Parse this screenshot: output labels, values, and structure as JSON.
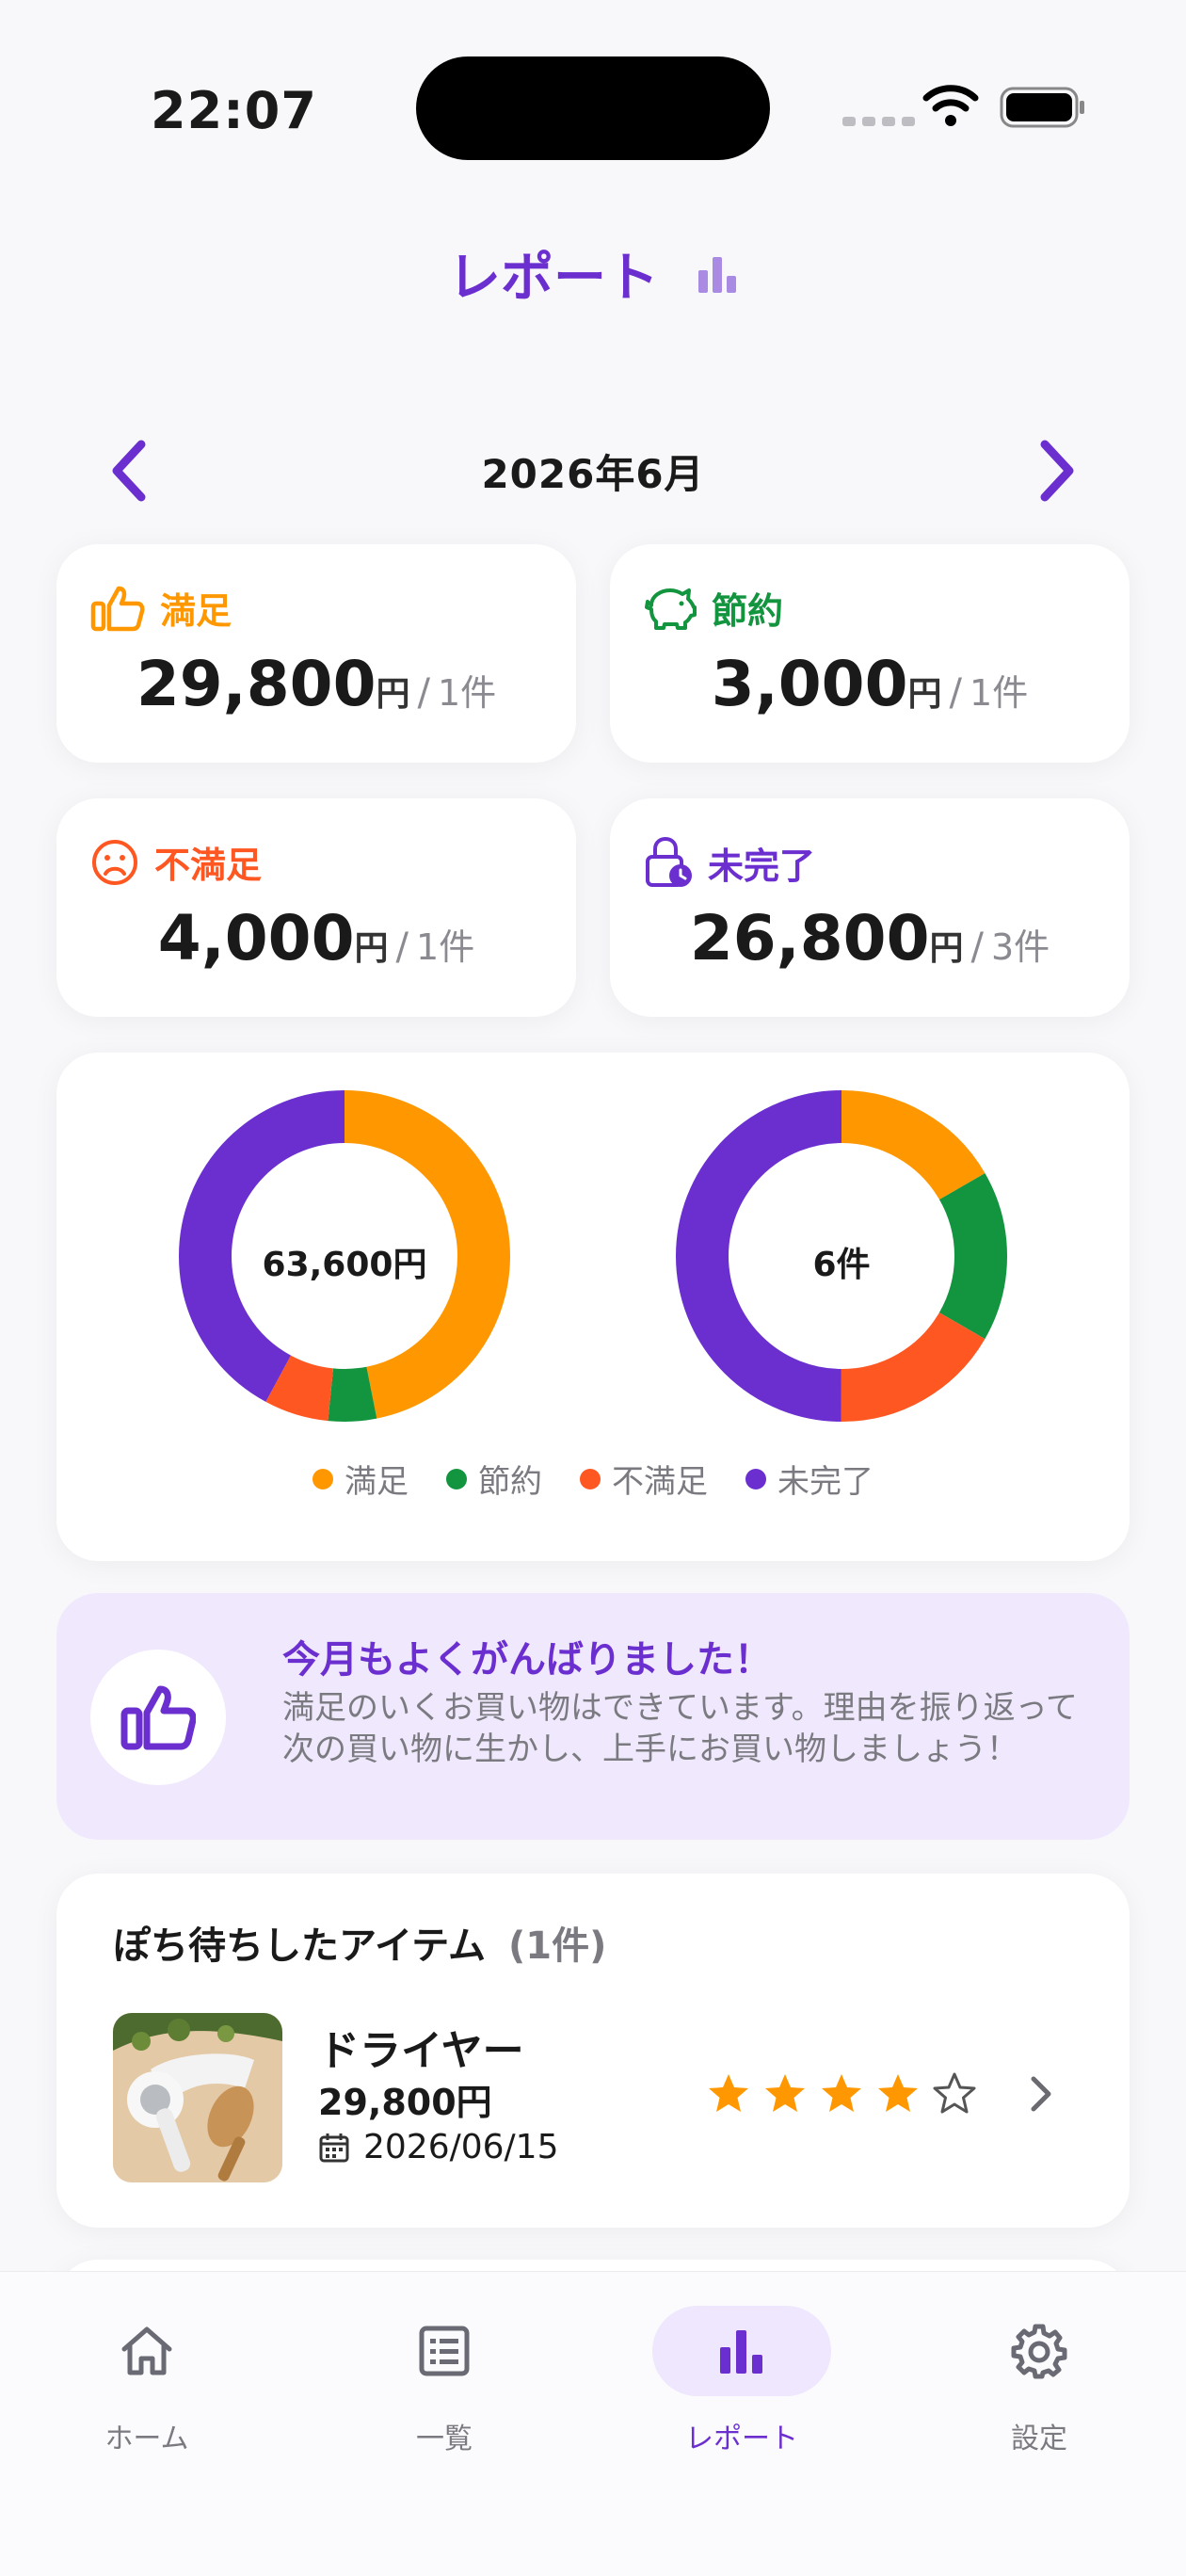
{
  "status": {
    "time": "22:07"
  },
  "header": {
    "title": "レポート"
  },
  "month_nav": {
    "label": "2026年6月"
  },
  "stats": [
    {
      "label": "満足",
      "amount": "29,800",
      "unit": "円",
      "sep": "/",
      "count": "1件",
      "color": "#ff9800"
    },
    {
      "label": "節約",
      "amount": "3,000",
      "unit": "円",
      "sep": "/",
      "count": "1件",
      "color": "#13943f"
    },
    {
      "label": "不満足",
      "amount": "4,000",
      "unit": "円",
      "sep": "/",
      "count": "1件",
      "color": "#ff5722"
    },
    {
      "label": "未完了",
      "amount": "26,800",
      "unit": "円",
      "sep": "/",
      "count": "3件",
      "color": "#6b2fd0"
    }
  ],
  "chart_data": [
    {
      "type": "pie",
      "center_label": "63,600円",
      "categories": [
        "満足",
        "節約",
        "不満足",
        "未完了"
      ],
      "values": [
        29800,
        3000,
        4000,
        26800
      ],
      "colors": [
        "#ff9800",
        "#13943f",
        "#ff5722",
        "#6b2fd0"
      ]
    },
    {
      "type": "pie",
      "center_label": "6件",
      "categories": [
        "満足",
        "節約",
        "不満足",
        "未完了"
      ],
      "values": [
        1,
        1,
        1,
        3
      ],
      "colors": [
        "#ff9800",
        "#13943f",
        "#ff5722",
        "#6b2fd0"
      ]
    }
  ],
  "legend": [
    {
      "label": "満足",
      "color": "#ff9800"
    },
    {
      "label": "節約",
      "color": "#13943f"
    },
    {
      "label": "不満足",
      "color": "#ff5722"
    },
    {
      "label": "未完了",
      "color": "#6b2fd0"
    }
  ],
  "message": {
    "title": "今月もよくがんばりました！",
    "body": "満足のいくお買い物はできています。理由を振り返って次の買い物に生かし、上手にお買い物しましょう！",
    "icon": "thumbs-up-icon"
  },
  "items": {
    "title": "ぽち待ちしたアイテム",
    "count": "(1件)",
    "list": [
      {
        "name": "ドライヤー",
        "price": "29,800円",
        "date": "2026/06/15",
        "rating": 4,
        "rating_max": 5
      }
    ]
  },
  "tabs": [
    {
      "label": "ホーム",
      "icon": "home-icon"
    },
    {
      "label": "一覧",
      "icon": "list-icon"
    },
    {
      "label": "レポート",
      "icon": "bar-chart-icon",
      "active": true
    },
    {
      "label": "設定",
      "icon": "gear-icon"
    }
  ],
  "colors": {
    "accent": "#6b2fd0",
    "accent_light": "#f0e9fd",
    "star": "#ff9800"
  }
}
